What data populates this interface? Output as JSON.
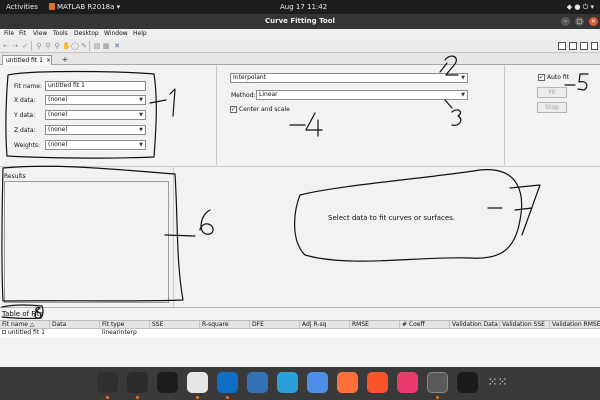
{
  "topbar": {
    "activities": "Activities",
    "app_name": "MATLAB R2018a ▾",
    "clock": "Aug 17  11:42",
    "status": "◆ ● ⏻ ▾"
  },
  "window": {
    "title": "Curve Fitting Tool"
  },
  "menu": [
    "File",
    "Fit",
    "View",
    "Tools",
    "Desktop",
    "Window",
    "Help"
  ],
  "toolbar": {
    "icons": [
      "new-fit-icon",
      "duplicate-icon",
      "pan-icon",
      "zoom-in-icon",
      "zoom-out-icon",
      "pan-hand-icon",
      "data-cursor-icon",
      "exclude-icon",
      "legend-icon",
      "grid-icon",
      "axes-icon"
    ],
    "layout_icons": [
      "layout-1-icon",
      "layout-2-icon",
      "layout-3-icon",
      "layout-4-icon"
    ]
  },
  "tabs": {
    "active": "untitled fit 1",
    "close": "×",
    "add": "+"
  },
  "data_selection": {
    "fit_name_label": "Fit name:",
    "fit_name_value": "untitled fit 1",
    "x_label": "X data:",
    "x_value": "(none)",
    "y_label": "Y data:",
    "y_value": "(none)",
    "z_label": "Z data:",
    "z_value": "(none)",
    "weights_label": "Weights:",
    "weights_value": "(none)"
  },
  "fit_options": {
    "fit_type": "Interpolant",
    "method_label": "Method:",
    "method_value": "Linear",
    "center_scale_label": "Center and scale",
    "center_scale_checked": true
  },
  "controls": {
    "auto_fit_label": "Auto fit",
    "auto_fit_checked": true,
    "fit_button": "Fit",
    "stop_button": "Stop"
  },
  "results": {
    "label": "Results"
  },
  "plot": {
    "message": "Select data to fit curves or surfaces."
  },
  "table": {
    "label": "Table of Fits",
    "headers": [
      "Fit name △",
      "Data",
      "Fit type",
      "SSE",
      "R-square",
      "DFE",
      "Adj R-sq",
      "RMSE",
      "# Coeff",
      "Validation Data",
      "Validation SSE",
      "Validation RMSE"
    ],
    "rows": [
      [
        "untitled fit 1",
        "",
        "linearinterp",
        "",
        "",
        "",
        "",
        "",
        "",
        "",
        "",
        ""
      ]
    ]
  },
  "annotations": [
    "1",
    "2",
    "3",
    "4",
    "5",
    "6",
    "7",
    "8"
  ],
  "dock": {
    "apps": [
      "files-icon",
      "terminal-icon",
      "pycharm-icon",
      "chrome-icon",
      "vscode-icon",
      "matlab-dock-icon",
      "telegram-icon",
      "chromium-icon",
      "firefox-icon",
      "brave-icon",
      "intellij-icon",
      "matlab-active-icon",
      "inkscape-icon",
      "app-grid-icon"
    ],
    "colors": [
      "#2f2f2f",
      "#2b2b2b",
      "#1c1c1c",
      "#e6e6e6",
      "#0f6fc4",
      "#3571b5",
      "#2a9fd9",
      "#4d8fe8",
      "#ff7139",
      "#fb542b",
      "#ea3b6d",
      "#5a5a5a",
      "#1b1b1b",
      "#3a3a3a"
    ]
  }
}
